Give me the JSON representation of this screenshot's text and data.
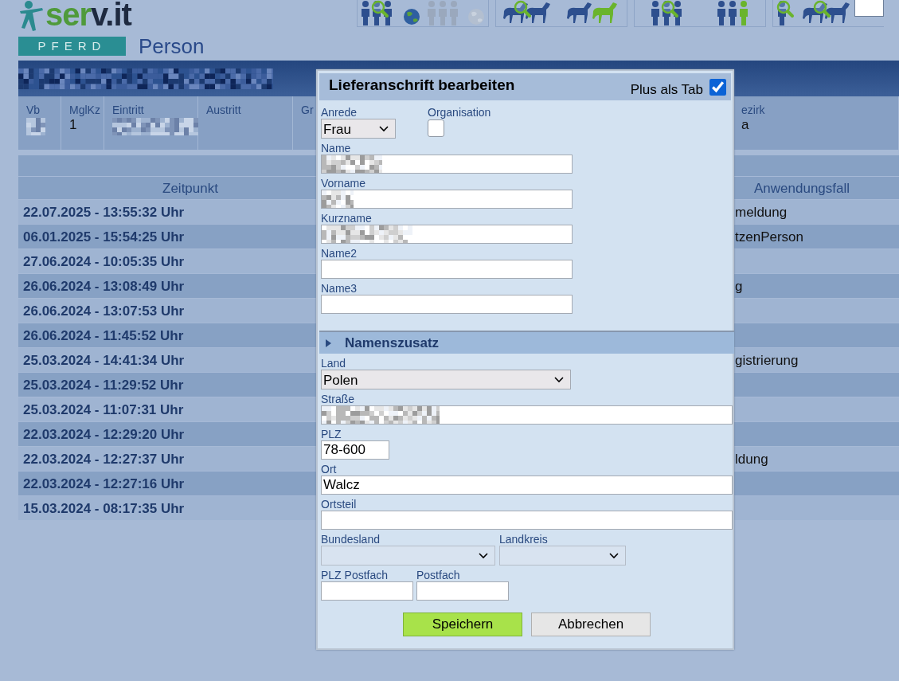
{
  "header": {
    "logo": "serv.it",
    "product": "PFERD",
    "page_title": "Person"
  },
  "toolbar": [
    {
      "items": [
        {
          "kind": "people-search",
          "disabled": false
        },
        {
          "kind": "globe",
          "disabled": false
        },
        {
          "kind": "people",
          "disabled": true
        },
        {
          "kind": "globe",
          "disabled": true
        }
      ]
    },
    {
      "items": [
        {
          "kind": "horse-search",
          "disabled": false
        },
        {
          "kind": "horses",
          "disabled": false
        }
      ]
    },
    {
      "items": [
        {
          "kind": "people-search",
          "disabled": false
        },
        {
          "kind": "people-highlight",
          "disabled": false
        }
      ]
    },
    {
      "items": [
        {
          "kind": "person-search",
          "disabled": false
        },
        {
          "kind": "horse-search",
          "disabled": false
        }
      ]
    }
  ],
  "title_bar": {
    "obscured": true
  },
  "info_columns": [
    {
      "label": "Vb",
      "obscured": true
    },
    {
      "label": "MglKz",
      "value": "1"
    },
    {
      "label": "Eintritt",
      "obscured": true
    },
    {
      "label": "Austritt"
    },
    {
      "label": "Gr"
    },
    {
      "label": "ezirk",
      "value": "a"
    }
  ],
  "table": {
    "columns": [
      "Zeitpunkt",
      "Anwendungsfall"
    ],
    "rows": [
      {
        "zeitpunkt": "22.07.2025 - 13:55:32 Uhr",
        "anwendungsfall": "meldung"
      },
      {
        "zeitpunkt": "06.01.2025 - 15:54:25 Uhr",
        "anwendungsfall": "tzenPerson"
      },
      {
        "zeitpunkt": "27.06.2024 - 10:05:35 Uhr"
      },
      {
        "zeitpunkt": "26.06.2024 - 13:08:49 Uhr",
        "anwendungsfall": "g"
      },
      {
        "zeitpunkt": "26.06.2024 - 13:07:53 Uhr"
      },
      {
        "zeitpunkt": "26.06.2024 - 11:45:52 Uhr"
      },
      {
        "zeitpunkt": "25.03.2024 - 14:41:34 Uhr",
        "anwendungsfall": "gistrierung"
      },
      {
        "zeitpunkt": "25.03.2024 - 11:29:52 Uhr"
      },
      {
        "zeitpunkt": "25.03.2024 - 11:07:31 Uhr"
      },
      {
        "zeitpunkt": "22.03.2024 - 12:29:20 Uhr"
      },
      {
        "zeitpunkt": "22.03.2024 - 12:27:37 Uhr",
        "anwendungsfall": "ldung"
      },
      {
        "zeitpunkt": "22.03.2024 - 12:27:16 Uhr"
      },
      {
        "zeitpunkt": "15.03.2024 - 08:17:35 Uhr"
      }
    ]
  },
  "dialog": {
    "title": "Lieferanschrift bearbeiten",
    "plus_als_tab": {
      "label": "Plus als Tab",
      "checked": true
    },
    "anrede": {
      "label": "Anrede",
      "value": "Frau"
    },
    "organisation": {
      "label": "Organisation",
      "checked": false
    },
    "name_fields": [
      {
        "label": "Name",
        "obscured": true
      },
      {
        "label": "Vorname",
        "obscured": true
      },
      {
        "label": "Kurzname",
        "obscured": true
      },
      {
        "label": "Name2"
      },
      {
        "label": "Name3"
      }
    ],
    "section": {
      "label": "Namenszusatz",
      "expanded": false
    },
    "land": {
      "label": "Land",
      "value": "Polen"
    },
    "strasse": {
      "label": "Straße",
      "obscured": true
    },
    "plz": {
      "label": "PLZ",
      "value": "78-600"
    },
    "ort": {
      "label": "Ort",
      "value": "Walcz"
    },
    "ortsteil": {
      "label": "Ortsteil"
    },
    "bundesland": {
      "label": "Bundesland",
      "disabled": true
    },
    "landkreis": {
      "label": "Landkreis",
      "disabled": true
    },
    "plz_postfach": {
      "label": "PLZ Postfach"
    },
    "postfach": {
      "label": "Postfach"
    },
    "buttons": [
      {
        "label": "Speichern",
        "kind": "primary"
      },
      {
        "label": "Abbrechen",
        "kind": "secondary"
      }
    ]
  }
}
